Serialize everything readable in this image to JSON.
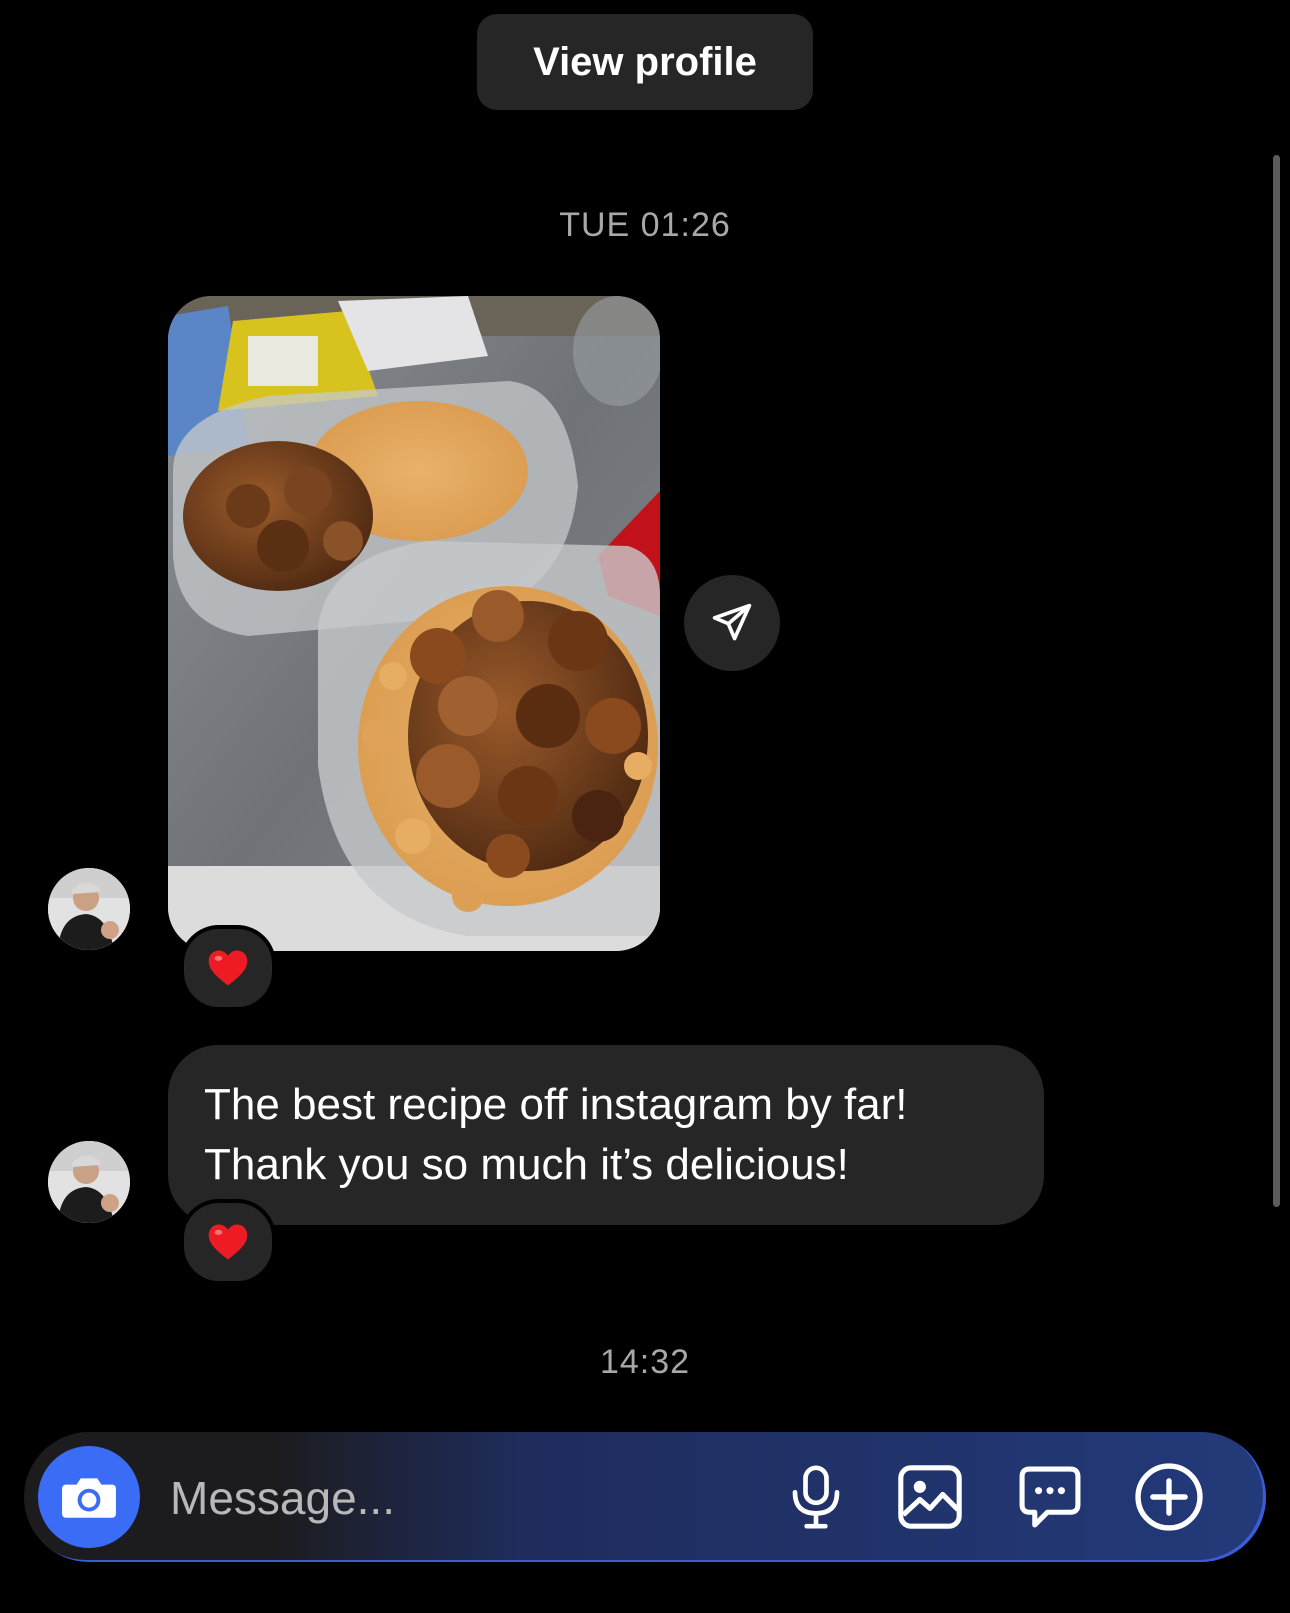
{
  "header": {
    "view_profile_label": "View profile"
  },
  "thread": {
    "timestamp_1": "TUE 01:26",
    "photo_message": {
      "reaction": "❤️"
    },
    "text_message": {
      "line_1": "The best recipe off instagram by far!",
      "line_2": "Thank you so much it’s delicious!",
      "reaction": "❤️"
    },
    "timestamp_2": "14:32"
  },
  "composer": {
    "placeholder": "Message..."
  },
  "colors": {
    "background": "#000000",
    "bubble": "#262626",
    "accent": "#3b6cf6",
    "timestamp": "#a8a8a8"
  },
  "icons": {
    "camera": "camera-icon",
    "share": "send-icon",
    "mic": "microphone-icon",
    "gallery": "image-icon",
    "sticker": "chat-bubble-icon",
    "plus": "plus-circle-icon"
  }
}
